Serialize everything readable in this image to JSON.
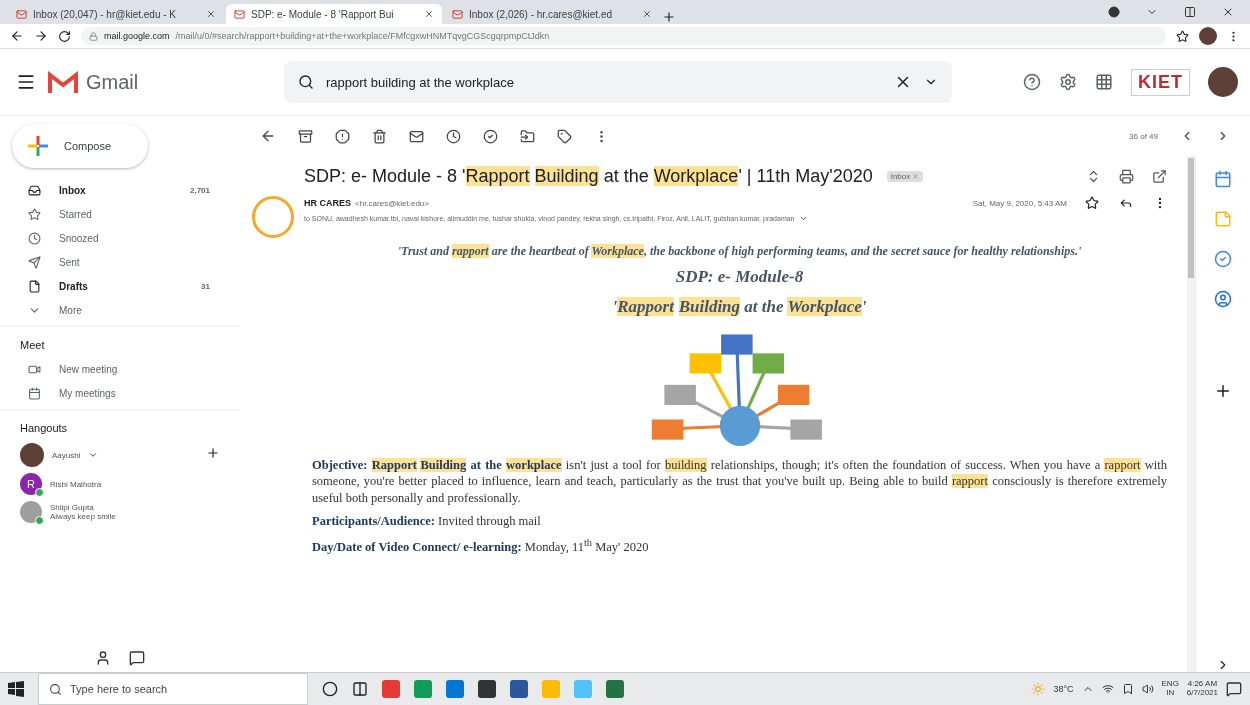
{
  "browser": {
    "tabs": [
      {
        "title": "Inbox (20,047) - hr@kiet.edu - K",
        "selected": false
      },
      {
        "title": "SDP: e- Module - 8 'Rapport Bui",
        "selected": true
      },
      {
        "title": "Inbox (2,026) - hr.cares@kiet.ed",
        "selected": false
      }
    ],
    "url_host": "mail.google.com",
    "url_path": "/mail/u/0/#search/rapport+building+at+the+workplace/FMfcgxwHNMTqvgCGScgqrpmpCtJdkn"
  },
  "header": {
    "brand": "Gmail",
    "search": "rapport building at the workplace",
    "org_logo": "KIET"
  },
  "sidebar": {
    "compose": "Compose",
    "items": [
      {
        "label": "Inbox",
        "count": "2,701",
        "unread": true,
        "kind": "inbox"
      },
      {
        "label": "Starred",
        "unread": false,
        "kind": "star"
      },
      {
        "label": "Snoozed",
        "unread": false,
        "kind": "clock"
      },
      {
        "label": "Sent",
        "unread": false,
        "kind": "send"
      },
      {
        "label": "Drafts",
        "count": "31",
        "unread": true,
        "kind": "draft"
      },
      {
        "label": "More",
        "unread": false,
        "kind": "more"
      }
    ],
    "meet": {
      "title": "Meet",
      "items": [
        {
          "label": "New meeting",
          "kind": "video"
        },
        {
          "label": "My meetings",
          "kind": "calendar"
        }
      ]
    },
    "hangouts": {
      "title": "Hangouts",
      "user": "Aayushi",
      "contacts": [
        {
          "name": "Rishi Malhotra",
          "initial": "R",
          "online": true,
          "color": "#8e24aa"
        },
        {
          "name": "Shilpi Gupta",
          "status": "Always keep smile",
          "online": true,
          "color": "#9e9e9e"
        }
      ]
    }
  },
  "toolbar": {
    "counter": "36 of 49"
  },
  "email": {
    "subject": [
      {
        "text": "SDP: e- Module - 8 '",
        "hl": false
      },
      {
        "text": "Rapport",
        "hl": true
      },
      {
        "text": "Building",
        "hl": true
      },
      {
        "text": " at the ",
        "hl": false
      },
      {
        "text": "Workplace",
        "hl": true
      },
      {
        "text": "' | 11th May'2020",
        "hl": false
      }
    ],
    "label": "Inbox",
    "sender": "HR CARES",
    "sender_email": "<hr.cares@kiet.edu>",
    "date": "Sat, May 9, 2020, 5:43 AM",
    "recipients": "to SONU, awadhesh kumar.tbi, naval kishore, alimuddin me, tushar shukla, vinod pandey, rekha singh, cs.tripathi, Firoz, Anil, LALIT, gulshan.kumar, pradaman",
    "quote": [
      {
        "text": "'Trust and ",
        "hl": false
      },
      {
        "text": "rapport",
        "hl": true
      },
      {
        "text": " are the heartbeat of  ",
        "hl": false
      },
      {
        "text": "Workplace",
        "hl": true
      },
      {
        "text": ", the backbone of high performing teams, and the secret sauce for healthy relationships.'",
        "hl": false
      }
    ],
    "heading": "SDP: e- Module-8",
    "title": [
      {
        "text": "'",
        "hl": false
      },
      {
        "text": "Rapport",
        "hl": true
      },
      {
        "text": "Building",
        "hl": true
      },
      {
        "text": " at the ",
        "hl": false
      },
      {
        "text": "Workplace",
        "hl": true
      },
      {
        "text": "'",
        "hl": false
      }
    ],
    "objective": [
      {
        "text": "Objective: ",
        "hl": false,
        "bold": true
      },
      {
        "text": "Rapport",
        "hl": true,
        "bold": true
      },
      {
        "text": "Building",
        "hl": true,
        "bold": true
      },
      {
        "text": " at the ",
        "hl": false,
        "bold": true
      },
      {
        "text": "workplace",
        "hl": true,
        "bold": true
      },
      {
        "text": " isn't just a tool for ",
        "hl": false,
        "bold": false
      },
      {
        "text": "building",
        "hl": true,
        "bold": false
      },
      {
        "text": " relationships, though; it's often the foundation of success. When you have a ",
        "hl": false,
        "bold": false
      },
      {
        "text": "rapport",
        "hl": true,
        "bold": false
      },
      {
        "text": " with someone, you're better placed to influence, learn and teach, particularly as the trust that you've built up. Being able to build ",
        "hl": false,
        "bold": false
      },
      {
        "text": "rapport",
        "hl": true,
        "bold": false
      },
      {
        "text": " consciously is therefore extremely useful both personally and professionally.",
        "hl": false,
        "bold": false
      }
    ],
    "participants_label": "Participants/Audience:",
    "participants": "Invited through mail",
    "date_label": "Day/Date of Video Connect/ e-learning:",
    "date_value": "Monday, 11$^{th}$ May' 2020"
  },
  "taskbar": {
    "search_placeholder": "Type here to search",
    "weather": "38°C",
    "lang": "ENG",
    "region": "IN",
    "time": "4:26 AM",
    "date": "6/7/2021"
  }
}
